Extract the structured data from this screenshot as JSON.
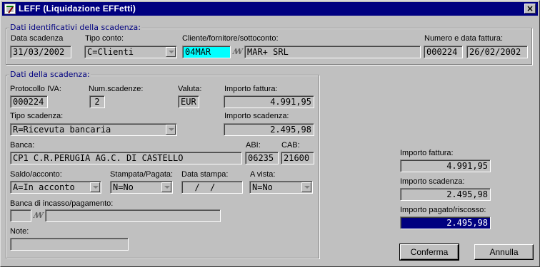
{
  "window": {
    "title": "LEFF (Liquidazione EFFetti)",
    "close_glyph": "×"
  },
  "group1": {
    "legend": "Dati identificativi della scadenza:",
    "data_scadenza_label": "Data scadenza",
    "data_scadenza": "31/03/2002",
    "tipo_conto_label": "Tipo conto:",
    "tipo_conto": "C=Clienti",
    "cliente_label": "Cliente/fornitore/sottoconto:",
    "cliente_code": "04MAR",
    "cliente_name": "MAR+ SRL",
    "numero_data_label": "Numero e data fattura:",
    "numero_fattura": "000224",
    "data_fattura": "26/02/2002"
  },
  "group2": {
    "legend": "Dati della scadenza:",
    "protocollo_label": "Protocollo IVA:",
    "protocollo": "000224",
    "num_scadenze_label": "Num.scadenze:",
    "num_scadenze": "2",
    "valuta_label": "Valuta:",
    "valuta": "EUR",
    "importo_fattura_label": "Importo fattura:",
    "importo_fattura": "4.991,95",
    "tipo_scadenza_label": "Tipo scadenza:",
    "tipo_scadenza": "R=Ricevuta bancaria",
    "importo_scadenza_label": "Importo scadenza:",
    "importo_scadenza": "2.495,98",
    "banca_label": "Banca:",
    "banca": "CP1 C.R.PERUGIA AG.C. DI CASTELLO",
    "abi_label": "ABI:",
    "abi": "06235",
    "cab_label": "CAB:",
    "cab": "21600",
    "saldo_label": "Saldo/acconto:",
    "saldo": "A=In acconto",
    "stampata_label": "Stampata/Pagata:",
    "stampata": "N=No",
    "data_stampa_label": "Data stampa:",
    "data_stampa": "  /  /",
    "a_vista_label": "A vista:",
    "a_vista": "N=No",
    "banca_incasso_label": "Banca di incasso/pagamento:",
    "banca_incasso_code": "",
    "banca_incasso_name": "",
    "note_label": "Note:",
    "note": ""
  },
  "summary": {
    "importo_fattura_label": "Importo fattura:",
    "importo_fattura": "4.991,95",
    "importo_scadenza_label": "Importo scadenza:",
    "importo_scadenza": "2.495,98",
    "importo_pagato_label": "Importo pagato/riscosso:",
    "importo_pagato": "2.495,98"
  },
  "buttons": {
    "conferma": "Conferma",
    "annulla": "Annulla"
  },
  "icons": {
    "lookup": "lookup-icon",
    "app": "app-icon",
    "close": "close-icon",
    "dropdown": "chevron-down-icon"
  },
  "colors": {
    "titlebar": "#000080",
    "highlight_field": "#00ffff",
    "selected_field": "#000080",
    "window": "#c0c0c0"
  }
}
